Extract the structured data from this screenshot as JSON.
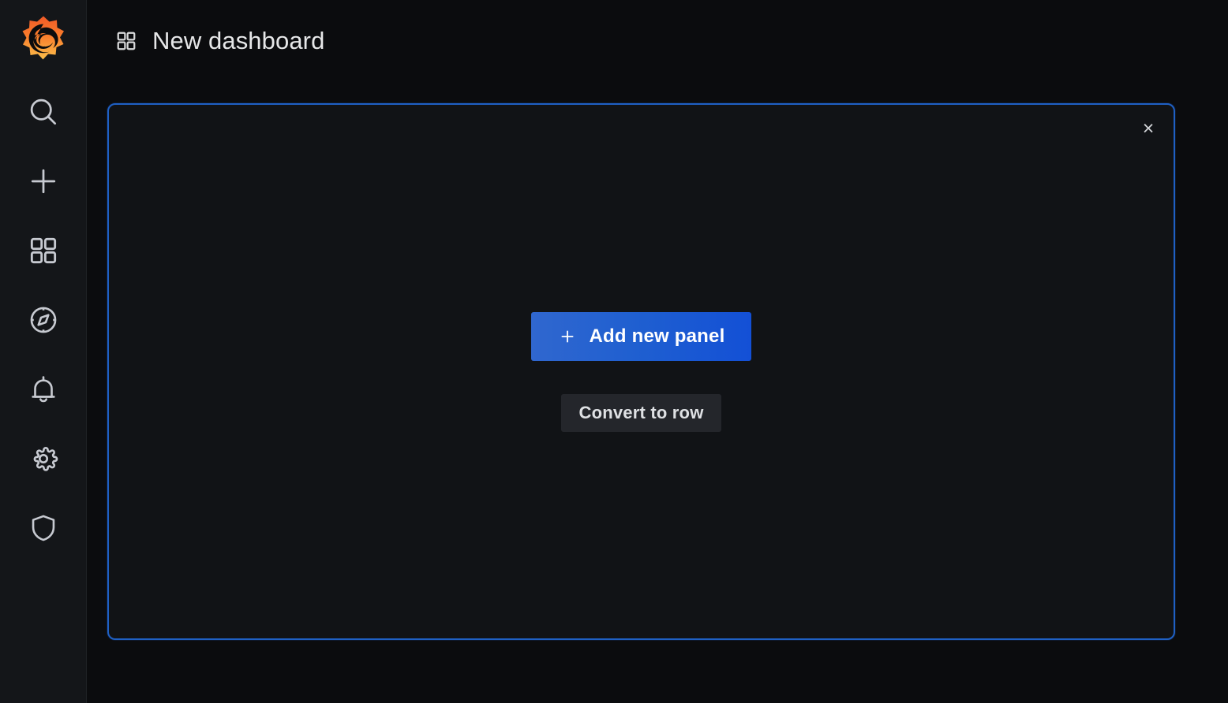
{
  "app": {
    "name": "Grafana",
    "logo_icon": "grafana-logo-icon",
    "background_color": "#0b0c0e",
    "sidebar_color": "#141619",
    "accent_color": "#1f60c4",
    "primary_button_color": "#1f5fd0",
    "secondary_button_color": "#24262b"
  },
  "sidebar": {
    "items": [
      {
        "name": "search",
        "icon": "search-icon",
        "label": "Search"
      },
      {
        "name": "create",
        "icon": "plus-icon",
        "label": "Create"
      },
      {
        "name": "dashboards",
        "icon": "apps-grid-icon",
        "label": "Dashboards"
      },
      {
        "name": "explore",
        "icon": "compass-icon",
        "label": "Explore"
      },
      {
        "name": "alerting",
        "icon": "bell-icon",
        "label": "Alerting"
      },
      {
        "name": "configuration",
        "icon": "gear-icon",
        "label": "Configuration"
      },
      {
        "name": "server-admin",
        "icon": "shield-icon",
        "label": "Server Admin"
      }
    ]
  },
  "header": {
    "icon": "apps-grid-icon",
    "title": "New dashboard"
  },
  "panel": {
    "close_label": "×",
    "add_panel_label": "Add new panel",
    "add_panel_icon": "plus-icon",
    "convert_row_label": "Convert to row"
  }
}
